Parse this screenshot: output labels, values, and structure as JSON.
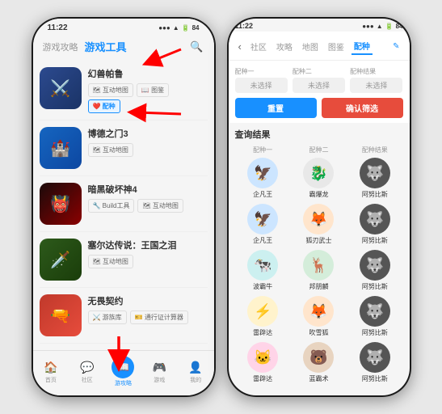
{
  "left_phone": {
    "status": {
      "time": "11:22",
      "battery": "84",
      "signal": "5G"
    },
    "header": {
      "tab_guide": "游戏攻略",
      "tab_tools": "游戏工具",
      "search_label": "搜索"
    },
    "games": [
      {
        "title": "幻兽帕鲁",
        "tags": [
          "互动地图",
          "图鉴",
          "配种"
        ],
        "highlight_tag": "配种",
        "thumb_class": "thumb-sword",
        "thumb_icon": "⚔️"
      },
      {
        "title": "博德之门3",
        "tags": [
          "互动地图"
        ],
        "highlight_tag": "",
        "thumb_class": "thumb-botw",
        "thumb_icon": "🏰"
      },
      {
        "title": "暗黑破坏神4",
        "tags": [
          "Build工具",
          "互动地图"
        ],
        "highlight_tag": "",
        "thumb_class": "thumb-diablo",
        "thumb_icon": "👹"
      },
      {
        "title": "塞尔达传说：王国之泪",
        "tags": [
          "互动地图"
        ],
        "highlight_tag": "",
        "thumb_class": "thumb-zelda",
        "thumb_icon": "🗡️"
      },
      {
        "title": "无畏契约",
        "tags": [
          "游族库",
          "通行证计算器"
        ],
        "highlight_tag": "",
        "thumb_class": "thumb-pokemon",
        "thumb_icon": "🔫"
      }
    ],
    "bottom_nav": [
      {
        "icon": "🏠",
        "label": "首页",
        "active": false
      },
      {
        "icon": "💬",
        "label": "社区",
        "active": false
      },
      {
        "icon": "📖",
        "label": "游攻略",
        "active": true
      },
      {
        "icon": "🎮",
        "label": "游戏",
        "active": false
      },
      {
        "icon": "👤",
        "label": "我的",
        "active": false
      }
    ]
  },
  "right_phone": {
    "status": {
      "time": "11:22",
      "battery": "84",
      "signal": "5G"
    },
    "nav_tabs": [
      "社区",
      "攻略",
      "地图",
      "图鉴",
      "配种",
      "✎"
    ],
    "active_tab": "配种",
    "breed_panel": {
      "label1": "配种一",
      "label2": "配种二",
      "label3": "配种结果",
      "placeholder": "未选择",
      "btn_reset": "重置",
      "btn_confirm": "确认筛选"
    },
    "results": {
      "title": "查询结果",
      "columns": [
        "配种一",
        "配种二",
        "配种结果"
      ],
      "rows": [
        {
          "p1": {
            "icon": "🦅",
            "color": "av-blue",
            "name": "企凡王"
          },
          "p2": {
            "icon": "🐉",
            "color": "av-gray",
            "name": "霸爆龙"
          },
          "p3": {
            "icon": "🐺",
            "color": "av-dark",
            "name": "阿努比斯"
          }
        },
        {
          "p1": {
            "icon": "🦅",
            "color": "av-blue",
            "name": "企凡王"
          },
          "p2": {
            "icon": "🦊",
            "color": "av-orange",
            "name": "狐刃武士"
          },
          "p3": {
            "icon": "🐺",
            "color": "av-dark",
            "name": "阿努比斯"
          }
        },
        {
          "p1": {
            "icon": "🐄",
            "color": "av-teal",
            "name": "波霸牛"
          },
          "p2": {
            "icon": "🦌",
            "color": "av-green",
            "name": "邦朋麟"
          },
          "p3": {
            "icon": "🐺",
            "color": "av-dark",
            "name": "阿努比斯"
          }
        },
        {
          "p1": {
            "icon": "⚡",
            "color": "av-yellow",
            "name": "雷辟达"
          },
          "p2": {
            "icon": "🦊",
            "color": "av-orange",
            "name": "吹雪狐"
          },
          "p3": {
            "icon": "🐺",
            "color": "av-dark",
            "name": "阿努比斯"
          }
        },
        {
          "p1": {
            "icon": "🐱",
            "color": "av-pink",
            "name": "雷辟达"
          },
          "p2": {
            "icon": "🐻",
            "color": "av-brown",
            "name": "蓝霸术"
          },
          "p3": {
            "icon": "🐺",
            "color": "av-dark",
            "name": "阿努比斯"
          }
        }
      ]
    }
  },
  "annotations": {
    "arrow1_label": "游戏工具 tab arrow",
    "arrow2_label": "配种 tag arrow",
    "arrow3_label": "bottom nav arrow"
  }
}
